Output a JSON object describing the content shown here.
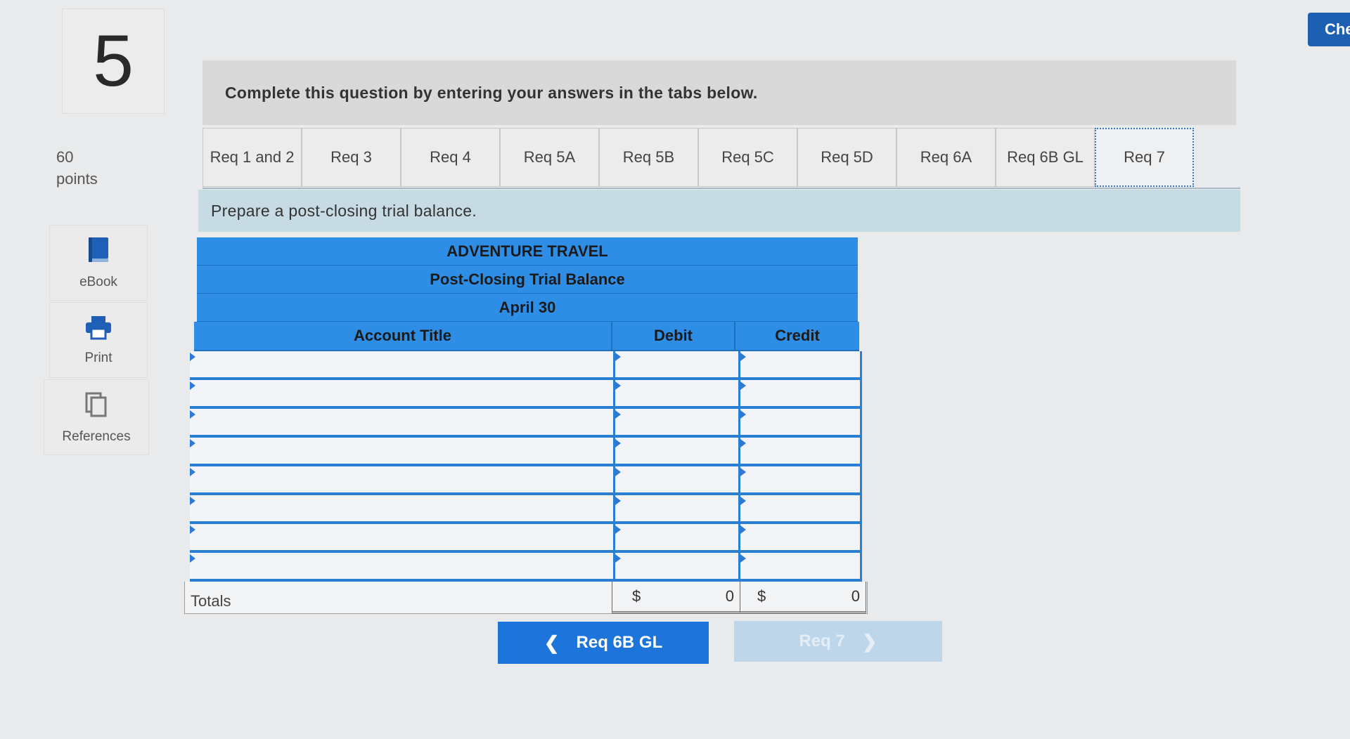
{
  "question": {
    "number": "5",
    "points_value": "60",
    "points_label": "points"
  },
  "tools": [
    {
      "label": "eBook",
      "icon": "book-icon"
    },
    {
      "label": "Print",
      "icon": "printer-icon"
    },
    {
      "label": "References",
      "icon": "copy-icon"
    }
  ],
  "instruction": "Complete this question by entering your answers in the tabs below.",
  "tabs": [
    "Req 1 and 2",
    "Req 3",
    "Req 4",
    "Req 5A",
    "Req 5B",
    "Req 5C",
    "Req 5D",
    "Req 6A",
    "Req 6B GL",
    "Req 7"
  ],
  "active_tab": "Req 7",
  "prompt": "Prepare a post-closing trial balance.",
  "trial_balance": {
    "company": "ADVENTURE TRAVEL",
    "statement": "Post-Closing Trial Balance",
    "date": "April 30",
    "col_account": "Account Title",
    "col_debit": "Debit",
    "col_credit": "Credit",
    "row_count": 8,
    "totals_label": "Totals",
    "debit_currency": "$",
    "debit_total": "0",
    "credit_currency": "$",
    "credit_total": "0"
  },
  "nav": {
    "prev_label": "Req 6B GL",
    "next_label": "Req 7",
    "check_label": "Che"
  },
  "colors": {
    "header_blue": "#2e8ee6",
    "button_blue": "#1d75db",
    "prompt_bg": "#c7dbe4"
  }
}
